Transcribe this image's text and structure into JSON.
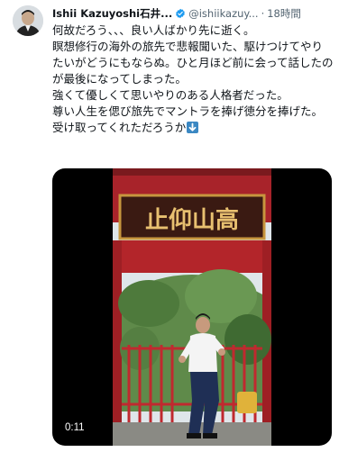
{
  "tweet": {
    "display_name": "Ishii Kazuyoshi石井...",
    "handle": "@ishiikazuy...",
    "separator": "·",
    "timestamp": "18時間",
    "lines": [
      "何故だろう、、、良い人ばかり先に逝く。",
      "瞑想修行の海外の旅先で悲報聞いた、駆けつけてやりたいがどうにもならぬ。ひと月ほど前に会って話したのが最後になってしまった。",
      "強くて優しくて思いやりのある人格者だった。",
      "尊い人生を偲び旅先でマントラを捧げ徳分を捧げた。",
      "受け取ってくれただろうか"
    ],
    "trailing_emoji": "down-arrow-emoji"
  },
  "media": {
    "type": "video",
    "duration": "0:11",
    "sign_text": "止仰山高"
  },
  "colors": {
    "verified": "#1d9bf0",
    "secondary_text": "#536471",
    "gate_red": "#b3252a",
    "sign_gold": "#e8c070"
  }
}
